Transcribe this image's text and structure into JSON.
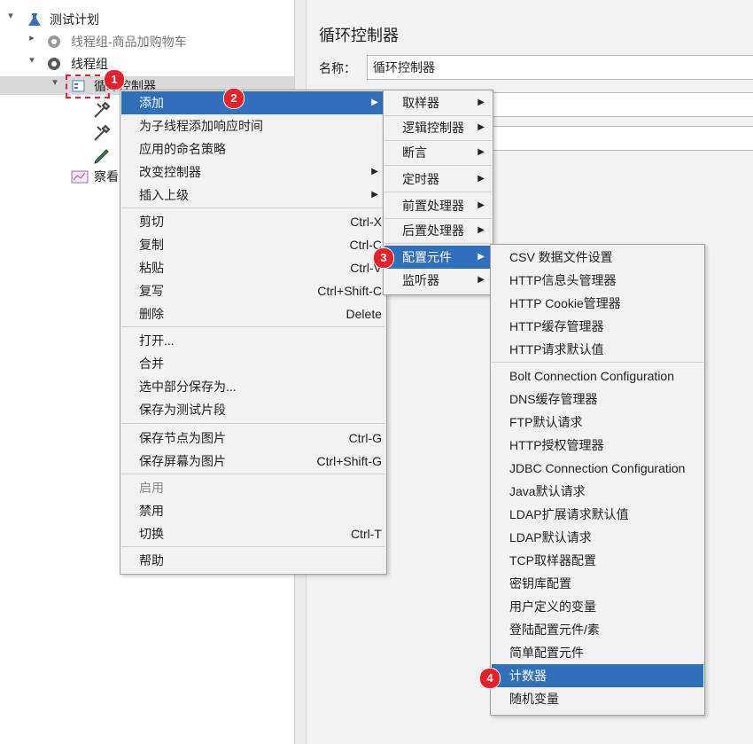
{
  "tree": {
    "root": "测试计划",
    "group1": "线程组-商品加购物车",
    "group2": "线程组",
    "loop_controller": "循环控制器",
    "child_listener": "察看"
  },
  "panel": {
    "title": "循环控制器",
    "name_label": "名称：",
    "name_value": "循环控制器"
  },
  "context_menu": {
    "items": [
      {
        "label": "添加",
        "shortcut": ""
      },
      {
        "label": "为子线程添加响应时间",
        "shortcut": ""
      },
      {
        "label": "应用的命名策略",
        "shortcut": ""
      },
      {
        "label": "改变控制器",
        "shortcut": ""
      },
      {
        "label": "插入上级",
        "shortcut": ""
      },
      {
        "label": "剪切",
        "shortcut": "Ctrl-X"
      },
      {
        "label": "复制",
        "shortcut": "Ctrl-C"
      },
      {
        "label": "粘贴",
        "shortcut": "Ctrl-V"
      },
      {
        "label": "复写",
        "shortcut": "Ctrl+Shift-C"
      },
      {
        "label": "删除",
        "shortcut": "Delete"
      },
      {
        "label": "打开...",
        "shortcut": ""
      },
      {
        "label": "合并",
        "shortcut": ""
      },
      {
        "label": "选中部分保存为...",
        "shortcut": ""
      },
      {
        "label": "保存为测试片段",
        "shortcut": ""
      },
      {
        "label": "保存节点为图片",
        "shortcut": "Ctrl-G"
      },
      {
        "label": "保存屏幕为图片",
        "shortcut": "Ctrl+Shift-G"
      },
      {
        "label": "启用",
        "shortcut": ""
      },
      {
        "label": "禁用",
        "shortcut": ""
      },
      {
        "label": "切换",
        "shortcut": "Ctrl-T"
      },
      {
        "label": "帮助",
        "shortcut": ""
      }
    ]
  },
  "add_menu": {
    "items": [
      "取样器",
      "逻辑控制器",
      "断言",
      "定时器",
      "前置处理器",
      "后置处理器",
      "配置元件",
      "监听器"
    ]
  },
  "config_menu": {
    "items": [
      "CSV 数据文件设置",
      "HTTP信息头管理器",
      "HTTP Cookie管理器",
      "HTTP缓存管理器",
      "HTTP请求默认值",
      "Bolt Connection Configuration",
      "DNS缓存管理器",
      "FTP默认请求",
      "HTTP授权管理器",
      "JDBC Connection Configuration",
      "Java默认请求",
      "LDAP扩展请求默认值",
      "LDAP默认请求",
      "TCP取样器配置",
      "密钥库配置",
      "用户定义的变量",
      "登陆配置元件/素",
      "简单配置元件",
      "计数器",
      "随机变量"
    ]
  },
  "badges": [
    "1",
    "2",
    "3",
    "4"
  ],
  "icons": {
    "submenu": "chevron-right-icon",
    "expand": "chevron-down-icon",
    "collapse": "chevron-right-icon"
  },
  "colors": {
    "highlight": "#2f6fbb",
    "badge": "#e8202a"
  }
}
